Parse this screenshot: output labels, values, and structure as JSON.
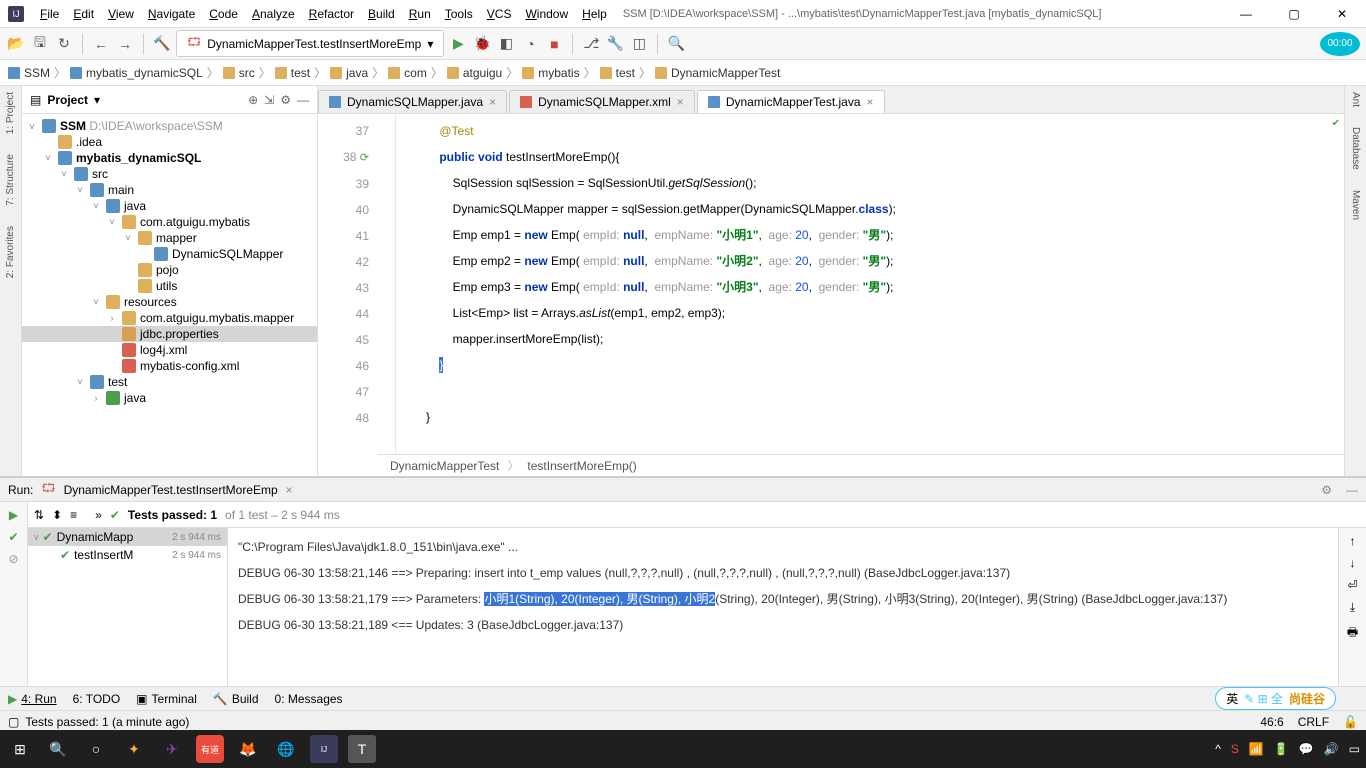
{
  "title": "SSM [D:\\IDEA\\workspace\\SSM] - ...\\mybatis\\test\\DynamicMapperTest.java [mybatis_dynamicSQL]",
  "menus": [
    "File",
    "Edit",
    "View",
    "Navigate",
    "Code",
    "Analyze",
    "Refactor",
    "Build",
    "Run",
    "Tools",
    "VCS",
    "Window",
    "Help"
  ],
  "runConfig": "DynamicMapperTest.testInsertMoreEmp",
  "timer": "00:00",
  "breadcrumbs": [
    "SSM",
    "mybatis_dynamicSQL",
    "src",
    "test",
    "java",
    "com",
    "atguigu",
    "mybatis",
    "test",
    "DynamicMapperTest"
  ],
  "projectTitle": "Project",
  "tree": {
    "root": "SSM",
    "rootPath": "D:\\IDEA\\workspace\\SSM",
    "nodes": [
      {
        "d": 1,
        "exp": "",
        "lbl": ".idea",
        "ic": "#ddb05c"
      },
      {
        "d": 1,
        "exp": "v",
        "lbl": "mybatis_dynamicSQL",
        "ic": "#5a91c4",
        "bold": true
      },
      {
        "d": 2,
        "exp": "v",
        "lbl": "src",
        "ic": "#5a91c4"
      },
      {
        "d": 3,
        "exp": "v",
        "lbl": "main",
        "ic": "#5a91c4"
      },
      {
        "d": 4,
        "exp": "v",
        "lbl": "java",
        "ic": "#5a91c4"
      },
      {
        "d": 5,
        "exp": "v",
        "lbl": "com.atguigu.mybatis",
        "ic": "#ddb05c"
      },
      {
        "d": 6,
        "exp": "v",
        "lbl": "mapper",
        "ic": "#ddb05c"
      },
      {
        "d": 7,
        "exp": "",
        "lbl": "DynamicSQLMapper",
        "ic": "#5a91c4"
      },
      {
        "d": 6,
        "exp": "",
        "lbl": "pojo",
        "ic": "#ddb05c"
      },
      {
        "d": 6,
        "exp": "",
        "lbl": "utils",
        "ic": "#ddb05c"
      },
      {
        "d": 4,
        "exp": "v",
        "lbl": "resources",
        "ic": "#ddb05c"
      },
      {
        "d": 5,
        "exp": ">",
        "lbl": "com.atguigu.mybatis.mapper",
        "ic": "#ddb05c"
      },
      {
        "d": 5,
        "exp": "",
        "lbl": "jdbc.properties",
        "ic": "#d8a050",
        "sel": true
      },
      {
        "d": 5,
        "exp": "",
        "lbl": "log4j.xml",
        "ic": "#d86050"
      },
      {
        "d": 5,
        "exp": "",
        "lbl": "mybatis-config.xml",
        "ic": "#d86050"
      },
      {
        "d": 3,
        "exp": "v",
        "lbl": "test",
        "ic": "#5a91c4"
      },
      {
        "d": 4,
        "exp": ">",
        "lbl": "java",
        "ic": "#4b9e4b"
      }
    ]
  },
  "tabs": [
    {
      "label": "DynamicSQLMapper.java",
      "icon": "#5a91c4",
      "active": false
    },
    {
      "label": "DynamicSQLMapper.xml",
      "icon": "#d86050",
      "active": false
    },
    {
      "label": "DynamicMapperTest.java",
      "icon": "#5a91c4",
      "active": true
    }
  ],
  "code": {
    "startLine": 37,
    "lines": [
      {
        "n": 37,
        "html": "    <span class='ann'>@Test</span>"
      },
      {
        "n": 38,
        "run": true,
        "html": "    <span class='kw'>public</span> <span class='kw'>void</span> testInsertMoreEmp(){"
      },
      {
        "n": 39,
        "html": "        SqlSession sqlSession = SqlSessionUtil.<span class='meth'>getSqlSession</span>();"
      },
      {
        "n": 40,
        "html": "        DynamicSQLMapper mapper = sqlSession.getMapper(DynamicSQLMapper.<span class='kw'>class</span>);"
      },
      {
        "n": 41,
        "html": "        Emp emp1 = <span class='kw'>new</span> Emp( <span class='hint'>empId:</span> <span class='kw'>null</span>,  <span class='hint'>empName:</span> <span class='str'>\"小明1\"</span>,  <span class='hint'>age:</span> <span class='num'>20</span>,  <span class='hint'>gender:</span> <span class='str'>\"男\"</span>);"
      },
      {
        "n": 42,
        "html": "        Emp emp2 = <span class='kw'>new</span> Emp( <span class='hint'>empId:</span> <span class='kw'>null</span>,  <span class='hint'>empName:</span> <span class='str'>\"小明2\"</span>,  <span class='hint'>age:</span> <span class='num'>20</span>,  <span class='hint'>gender:</span> <span class='str'>\"男\"</span>);"
      },
      {
        "n": 43,
        "html": "        Emp emp3 = <span class='kw'>new</span> Emp( <span class='hint'>empId:</span> <span class='kw'>null</span>,  <span class='hint'>empName:</span> <span class='str'>\"小明3\"</span>,  <span class='hint'>age:</span> <span class='num'>20</span>,  <span class='hint'>gender:</span> <span class='str'>\"男\"</span>);"
      },
      {
        "n": 44,
        "html": "        List&lt;Emp&gt; list = Arrays.<span class='meth'>asList</span>(emp1, emp2, emp3);"
      },
      {
        "n": 45,
        "html": "        mapper.insertMoreEmp(list);"
      },
      {
        "n": 46,
        "html": "    <span class='selbg'>}</span>"
      },
      {
        "n": 47,
        "html": ""
      },
      {
        "n": 48,
        "html": "}"
      }
    ]
  },
  "breadcrumb2": [
    "DynamicMapperTest",
    "testInsertMoreEmp()"
  ],
  "run": {
    "title": "DynamicMapperTest.testInsertMoreEmp",
    "summary_pre": "Tests passed: 1",
    "summary_post": " of 1 test – 2 s 944 ms",
    "nodes": [
      {
        "lbl": "DynamicMapp",
        "time": "2 s 944 ms",
        "sel": true,
        "pass": true,
        "exp": "v"
      },
      {
        "lbl": "testInsertM",
        "time": "2 s 944 ms",
        "sel": false,
        "pass": true,
        "exp": "",
        "indent": 1
      }
    ]
  },
  "console": [
    "\"C:\\Program Files\\Java\\jdk1.8.0_151\\bin\\java.exe\" ...",
    "DEBUG 06-30 13:58:21,146 ==>  Preparing: insert into t_emp values (null,?,?,?,null) , (null,?,?,?,null) , (null,?,?,?,null)  (BaseJdbcLogger.java:137)",
    "DEBUG 06-30 13:58:21,179 ==> Parameters: <span class='hl'>小明1(String), 20(Integer), 男(String), 小明2</span>(String), 20(Integer), 男(String), 小明3(String), 20(Integer), 男(String)  (BaseJdbcLogger.java:137)",
    "DEBUG 06-30 13:58:21,189 <==    Updates: 3  (BaseJdbcLogger.java:137)"
  ],
  "bottomTabs": [
    "4: Run",
    "6: TODO",
    "Terminal",
    "Build",
    "0: Messages"
  ],
  "status": {
    "msg": "Tests passed: 1 (a minute ago)",
    "pos": "46:6",
    "enc": "CRLF"
  },
  "badge": {
    "a": "英",
    "b": "尚硅谷"
  },
  "leftRail": [
    "1: Project",
    "7: Structure",
    "2: Favorites"
  ],
  "rightRailItems": [
    "Ant",
    "Database",
    "Maven"
  ]
}
